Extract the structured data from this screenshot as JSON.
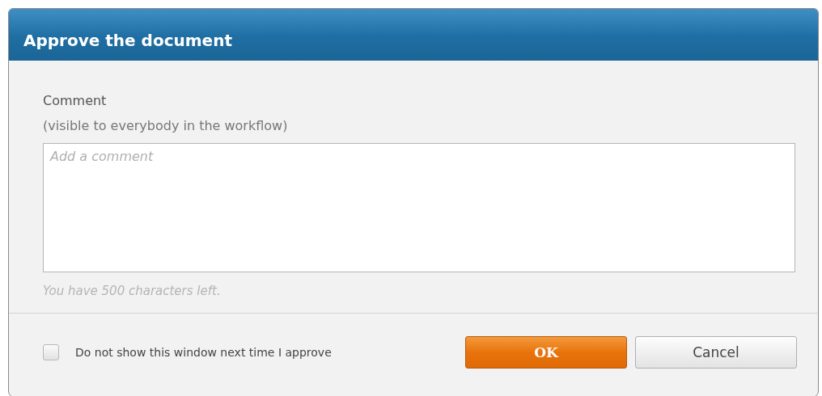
{
  "dialog": {
    "title": "Approve the document",
    "comment": {
      "label": "Comment",
      "hint": "(visible to everybody in the workflow)",
      "placeholder": "Add a comment",
      "counter": "You have 500 characters left."
    },
    "dont_show": {
      "label": "Do not show this window next time I approve",
      "checked": false
    },
    "buttons": [
      {
        "label": "OK",
        "kind": "primary"
      },
      {
        "label": "Cancel",
        "kind": "secondary"
      }
    ]
  }
}
